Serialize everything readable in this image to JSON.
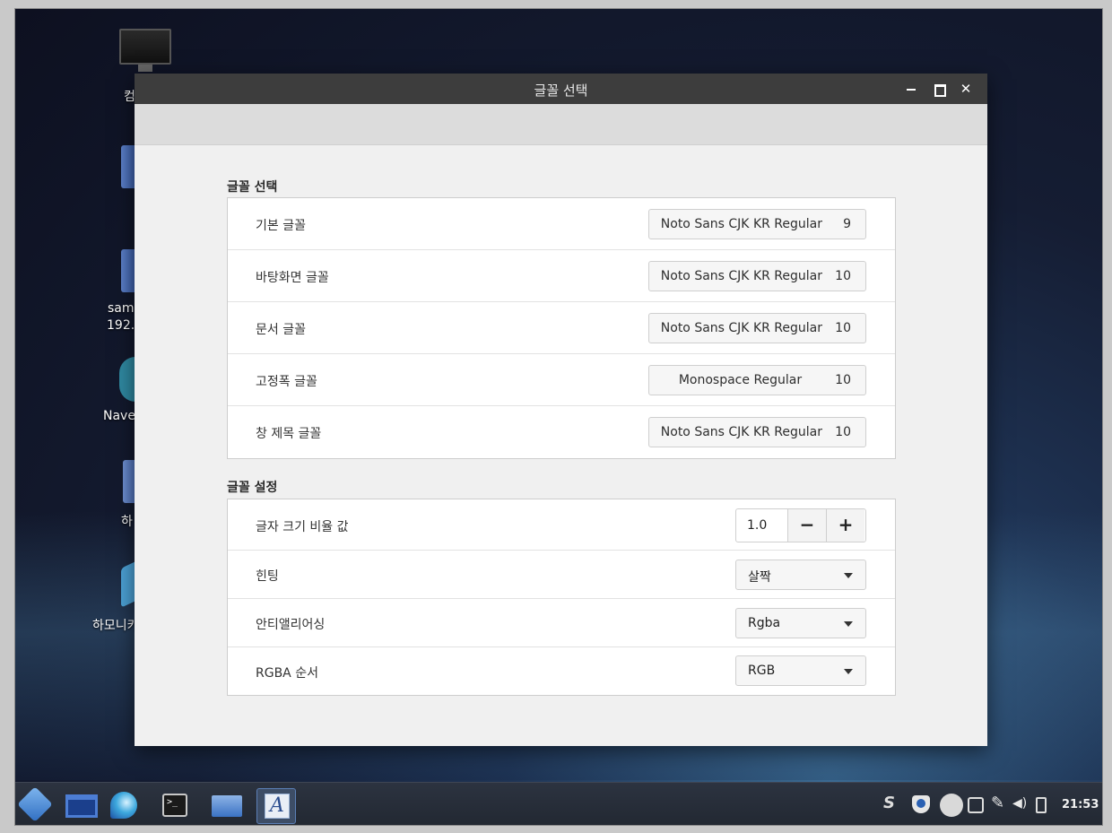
{
  "desktop": {
    "labels": [
      "컴",
      "sam",
      "192.",
      "Nave",
      "하",
      "하모니카"
    ]
  },
  "window": {
    "title": "글꼴 선택"
  },
  "fonts_section": {
    "title": "글꼴 선택",
    "rows": [
      {
        "label": "기본 글꼴",
        "font": "Noto Sans CJK KR Regular",
        "size": "9"
      },
      {
        "label": "바탕화면 글꼴",
        "font": "Noto Sans CJK KR Regular",
        "size": "10"
      },
      {
        "label": "문서 글꼴",
        "font": "Noto Sans CJK KR Regular",
        "size": "10"
      },
      {
        "label": "고정폭 글꼴",
        "font": "Monospace Regular",
        "size": "10"
      },
      {
        "label": "창 제목 글꼴",
        "font": "Noto Sans CJK KR Regular",
        "size": "10"
      }
    ]
  },
  "settings_section": {
    "title": "글꼴 설정",
    "scale": {
      "label": "글자 크기 비율 값",
      "value": "1.0",
      "minus": "−",
      "plus": "+"
    },
    "hinting": {
      "label": "힌팅",
      "value": "살짝"
    },
    "antialias": {
      "label": "안티앨리어싱",
      "value": "Rgba"
    },
    "rgba_order": {
      "label": "RGBA 순서",
      "value": "RGB"
    }
  },
  "taskbar": {
    "font_app_glyph": "A",
    "terminal_glyph": ">_",
    "tray_s_glyph": "S",
    "clock": "21:53"
  }
}
